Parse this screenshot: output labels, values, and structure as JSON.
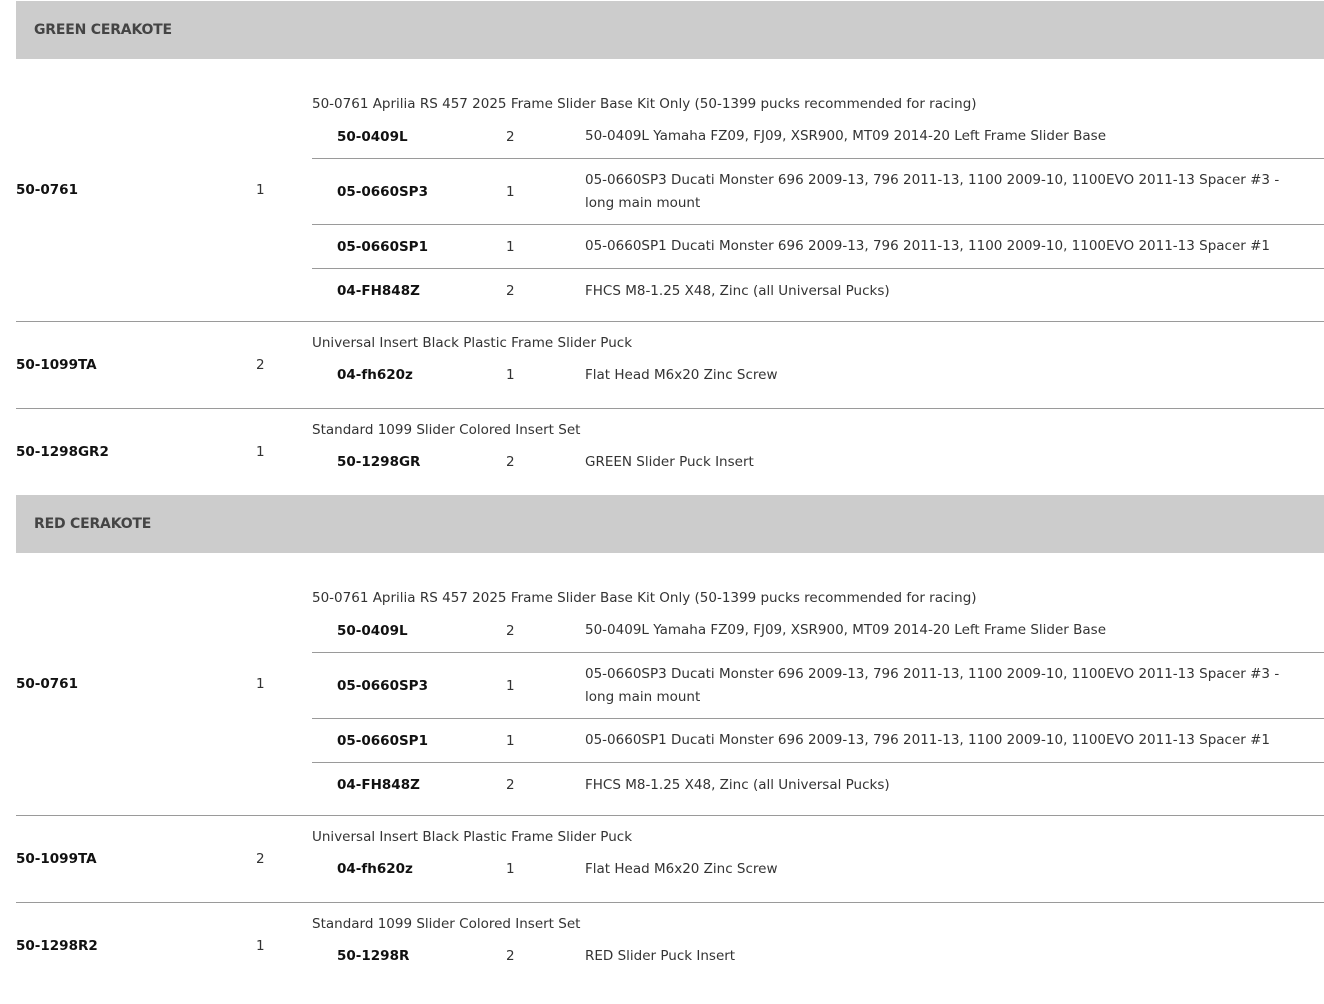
{
  "sections": [
    {
      "title": "GREEN CERAKOTE",
      "kits": [
        {
          "part": "50-0761",
          "qty": "1",
          "title": "50-0761 Aprilia RS 457 2025 Frame Slider Base Kit Only (50-1399 pucks recommended for racing)",
          "items": [
            {
              "part": "50-0409L",
              "qty": "2",
              "desc": "50-0409L Yamaha FZ09, FJ09, XSR900, MT09 2014-20 Left Frame Slider Base"
            },
            {
              "part": "05-0660SP3",
              "qty": "1",
              "desc": "05-0660SP3 Ducati Monster 696 2009-13, 796 2011-13, 1100 2009-10, 1100EVO 2011-13 Spacer #3 - long main mount"
            },
            {
              "part": "05-0660SP1",
              "qty": "1",
              "desc": "05-0660SP1 Ducati Monster 696 2009-13, 796 2011-13, 1100 2009-10, 1100EVO 2011-13 Spacer #1"
            },
            {
              "part": "04-FH848Z",
              "qty": "2",
              "desc": "FHCS M8-1.25 X48, Zinc (all Universal Pucks)"
            }
          ]
        },
        {
          "part": "50-1099TA",
          "qty": "2",
          "title": "Universal Insert Black Plastic Frame Slider Puck",
          "items": [
            {
              "part": "04-fh620z",
              "qty": "1",
              "desc": "Flat Head M6x20 Zinc Screw"
            }
          ]
        },
        {
          "part": "50-1298GR2",
          "qty": "1",
          "title": "Standard 1099 Slider Colored Insert Set",
          "items": [
            {
              "part": "50-1298GR",
              "qty": "2",
              "desc": "GREEN Slider Puck Insert"
            }
          ]
        }
      ]
    },
    {
      "title": "RED CERAKOTE",
      "kits": [
        {
          "part": "50-0761",
          "qty": "1",
          "title": "50-0761 Aprilia RS 457 2025 Frame Slider Base Kit Only (50-1399 pucks recommended for racing)",
          "items": [
            {
              "part": "50-0409L",
              "qty": "2",
              "desc": "50-0409L Yamaha FZ09, FJ09, XSR900, MT09 2014-20 Left Frame Slider Base"
            },
            {
              "part": "05-0660SP3",
              "qty": "1",
              "desc": "05-0660SP3 Ducati Monster 696 2009-13, 796 2011-13, 1100 2009-10, 1100EVO 2011-13 Spacer #3 - long main mount"
            },
            {
              "part": "05-0660SP1",
              "qty": "1",
              "desc": "05-0660SP1 Ducati Monster 696 2009-13, 796 2011-13, 1100 2009-10, 1100EVO 2011-13 Spacer #1"
            },
            {
              "part": "04-FH848Z",
              "qty": "2",
              "desc": "FHCS M8-1.25 X48, Zinc (all Universal Pucks)"
            }
          ]
        },
        {
          "part": "50-1099TA",
          "qty": "2",
          "title": "Universal Insert Black Plastic Frame Slider Puck",
          "items": [
            {
              "part": "04-fh620z",
              "qty": "1",
              "desc": "Flat Head M6x20 Zinc Screw"
            }
          ]
        },
        {
          "part": "50-1298R2",
          "qty": "1",
          "title": "Standard 1099 Slider Colored Insert Set",
          "items": [
            {
              "part": "50-1298R",
              "qty": "2",
              "desc": "RED Slider Puck Insert"
            }
          ]
        }
      ]
    }
  ]
}
